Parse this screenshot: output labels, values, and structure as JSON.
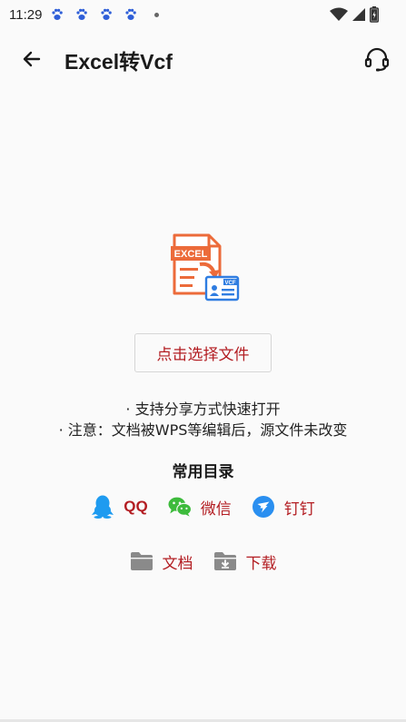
{
  "status_bar": {
    "time": "11:29",
    "notification_icons": [
      "baidu-paw-icon",
      "baidu-paw-icon",
      "baidu-paw-icon",
      "baidu-paw-icon"
    ],
    "right_icons": [
      "wifi-icon",
      "cell-signal-icon",
      "battery-charging-icon"
    ]
  },
  "app_bar": {
    "title": "Excel转Vcf",
    "back_icon": "arrow-left-icon",
    "support_icon": "headset-icon"
  },
  "main": {
    "graphic": {
      "excel_label": "EXCEL",
      "vcf_label": "VCF"
    },
    "pick_button_label": "点击选择文件",
    "hints": [
      "· 支持分享方式快速打开",
      "· 注意：文档被WPS等编辑后，源文件未改变"
    ],
    "section_title": "常用目录",
    "directories": [
      {
        "label": "QQ",
        "icon": "qq-penguin-icon"
      },
      {
        "label": "微信",
        "icon": "wechat-icon"
      },
      {
        "label": "钉钉",
        "icon": "dingtalk-icon"
      },
      {
        "label": "文档",
        "icon": "folder-icon"
      },
      {
        "label": "下载",
        "icon": "download-folder-icon"
      }
    ]
  },
  "colors": {
    "accent_red": "#b31d22",
    "excel_orange": "#ec6b3a",
    "vcf_blue": "#2f7de1",
    "wechat_green": "#3dbb3c",
    "qq_blue": "#1e9bf0",
    "folder_gray": "#8a8a8a"
  }
}
